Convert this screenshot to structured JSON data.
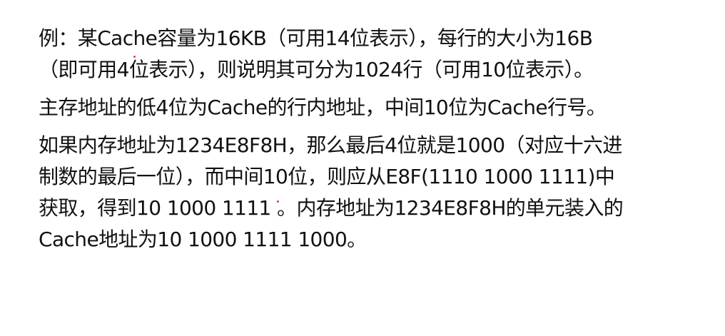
{
  "document": {
    "lines": [
      "例：某Cache容量为16KB（可用14位表示），每行的大小为16B",
      "（即可用4位表示），则说明其可分为1024行（可用10位表示）。",
      "主存地址的低4位为Cache的行内地址，中间10位为Cache行号。",
      "如果内存地址为1234E8F8H，那么最后4位就是1000（对应十六进",
      "制数的最后一位），而中间10位，则应从E8F(1110 1000 1111)中",
      "获取，得到10 1000 1111 。内存地址为1234E8F8H的单元装入的",
      "Cache地址为10 1000 1111 1000。"
    ]
  },
  "colors": {
    "text": "#111111",
    "background": "#ffffff",
    "annotation_mark": "#e53935"
  }
}
